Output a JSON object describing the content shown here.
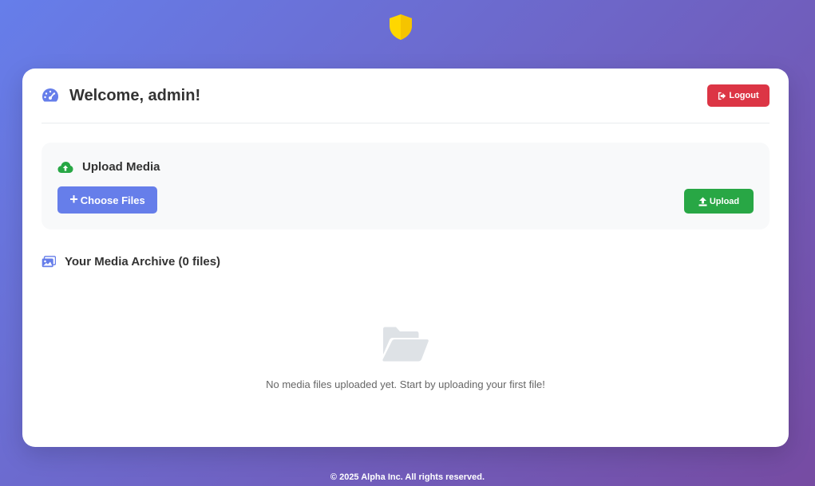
{
  "header": {
    "welcome_text": "Welcome, admin!",
    "logout_label": "Logout"
  },
  "upload": {
    "title": "Upload Media",
    "choose_files_label": "Choose Files",
    "upload_label": "Upload"
  },
  "archive": {
    "title": "Your Media Archive (0 files)",
    "empty_message": "No media files uploaded yet. Start by uploading your first file!"
  },
  "footer": {
    "text": "© 2025 Alpha Inc. All rights reserved."
  },
  "icons": {
    "logo": "shield-icon",
    "dashboard": "tachometer-icon",
    "logout": "sign-out-icon",
    "upload_section": "cloud-upload-icon",
    "choose": "plus-icon",
    "upload_button": "upload-icon",
    "archive": "images-icon",
    "empty_state": "folder-open-icon"
  },
  "colors": {
    "bg_start": "#667eea",
    "bg_end": "#764ba2",
    "primary": "#667eea",
    "danger": "#dc3545",
    "success": "#28a745",
    "shield": "#ffd700",
    "folder": "#dee2e6"
  }
}
